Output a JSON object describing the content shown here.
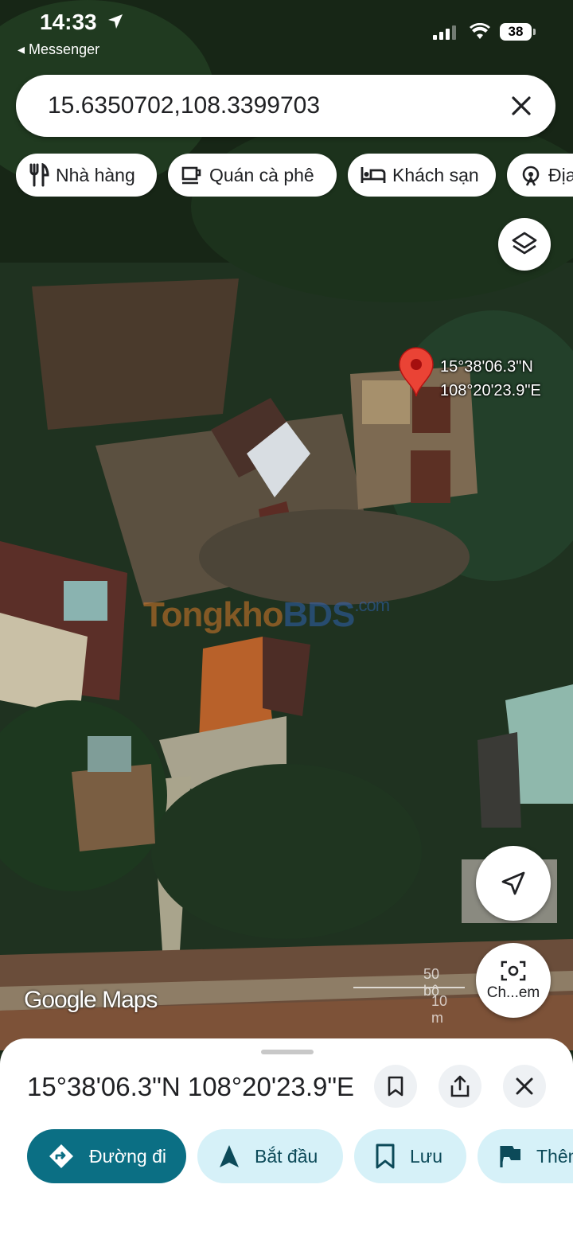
{
  "status_bar": {
    "time": "14:33",
    "back_app": "Messenger",
    "battery": "38"
  },
  "search": {
    "value": "15.6350702,108.3399703"
  },
  "chips": [
    {
      "label": "Nhà hàng",
      "icon": "restaurant-icon"
    },
    {
      "label": "Quán cà phê",
      "icon": "coffee-icon"
    },
    {
      "label": "Khách sạn",
      "icon": "hotel-icon"
    },
    {
      "label": "Địa",
      "icon": "attraction-icon"
    }
  ],
  "map": {
    "pin_label_lat": "15°38'06.3\"N",
    "pin_label_lng": "108°20'23.9\"E",
    "watermark_part1": "Tongkho",
    "watermark_part2": "BDS",
    "watermark_domain": ".com",
    "attribution": "Google Maps",
    "scale_feet": "50 bộ",
    "scale_meters": "10 m",
    "lens_label": "Ch...em"
  },
  "sheet": {
    "title": "15°38'06.3\"N 108°20'23.9\"E",
    "actions": [
      {
        "label": "Đường đi",
        "icon": "directions-icon",
        "style": "primary"
      },
      {
        "label": "Bắt đầu",
        "icon": "navigation-icon",
        "style": "secondary"
      },
      {
        "label": "Lưu",
        "icon": "bookmark-icon",
        "style": "secondary"
      },
      {
        "label": "Thêm",
        "icon": "flag-icon",
        "style": "secondary"
      }
    ]
  },
  "colors": {
    "primary_action": "#0b6f84",
    "secondary_action": "#d6f1f8",
    "pin": "#ea4335"
  }
}
